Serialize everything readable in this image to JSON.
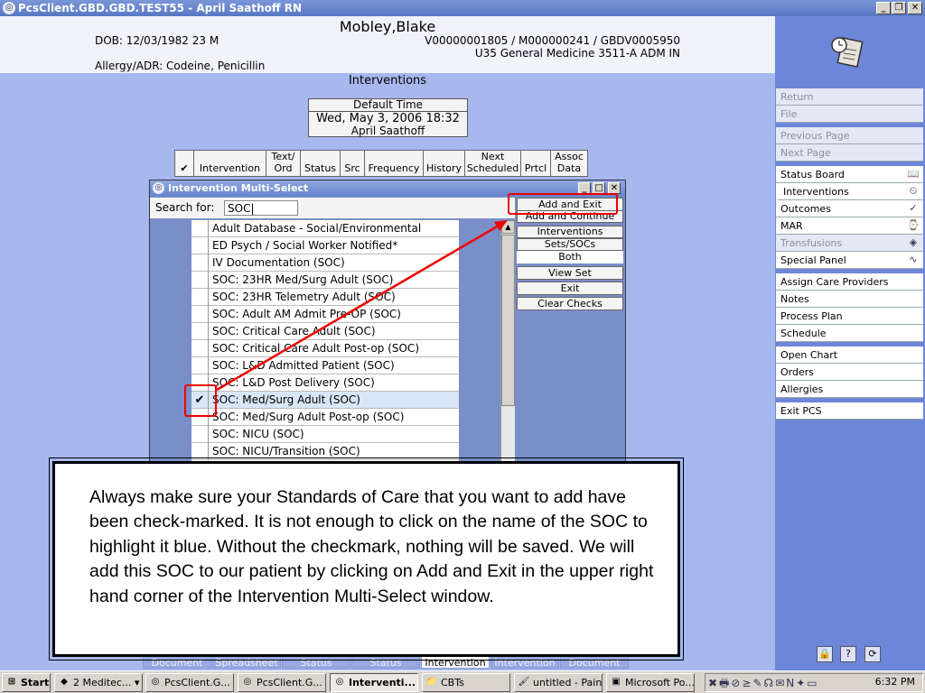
{
  "window": {
    "title": "PcsClient.GBD.GBD.TEST55 - April Saathoff RN"
  },
  "header": {
    "patient_name": "Mobley,Blake",
    "dob": "DOB: 12/03/1982 23 M",
    "ids": "V00000001805 / M000000241 / GBDV0005950",
    "location": "U35 General Medicine  3511-A  ADM IN",
    "allergy": "Allergy/ADR: Codeine, Penicillin"
  },
  "section_title": "Interventions",
  "default_time": {
    "label": "Default Time",
    "value": "Wed, May 3, 2006  18:32",
    "user": "April Saathoff"
  },
  "columns": [
    {
      "label": "✔"
    },
    {
      "label": "Intervention"
    },
    {
      "label": "Text/ Ord"
    },
    {
      "label": "Status"
    },
    {
      "label": "Src"
    },
    {
      "label": "Frequency"
    },
    {
      "label": "History"
    },
    {
      "label": "Next Scheduled"
    },
    {
      "label": "Prtcl"
    },
    {
      "label": "Assoc Data"
    }
  ],
  "dialog": {
    "title": "Intervention Multi-Select",
    "search_label": "Search for:",
    "search_value": "SOC|",
    "items": [
      {
        "label": "Adult Database - Social/Environmental",
        "checked": ""
      },
      {
        "label": "ED Psych / Social Worker Notified*",
        "checked": ""
      },
      {
        "label": "IV Documentation (SOC)",
        "checked": ""
      },
      {
        "label": "SOC: 23HR Med/Surg Adult (SOC)",
        "checked": ""
      },
      {
        "label": "SOC: 23HR Telemetry Adult (SOC)",
        "checked": ""
      },
      {
        "label": "SOC: Adult AM Admit Pre-OP (SOC)",
        "checked": ""
      },
      {
        "label": "SOC: Critical Care Adult (SOC)",
        "checked": ""
      },
      {
        "label": "SOC: Critical Care Adult Post-op (SOC)",
        "checked": ""
      },
      {
        "label": "SOC: L&D Admitted Patient (SOC)",
        "checked": ""
      },
      {
        "label": "SOC: L&D Post Delivery (SOC)",
        "checked": ""
      },
      {
        "label": "SOC: Med/Surg Adult (SOC)",
        "checked": "✔"
      },
      {
        "label": "SOC: Med/Surg Adult Post-op (SOC)",
        "checked": ""
      },
      {
        "label": "SOC: NICU (SOC)",
        "checked": ""
      },
      {
        "label": "SOC: NICU/Transition (SOC)",
        "checked": ""
      }
    ],
    "buttons": {
      "add_exit": "Add and Exit",
      "add_continue": "Add and Continue",
      "interventions": "Interventions",
      "sets_socs": "Sets/SOCs",
      "both": "Both",
      "view_set": "View Set",
      "exit": "Exit",
      "clear_checks": "Clear Checks"
    }
  },
  "sidebar": {
    "items": [
      {
        "label": "Return",
        "icon": ""
      },
      {
        "label": "File",
        "icon": ""
      },
      {
        "label": "Previous Page",
        "icon": ""
      },
      {
        "label": "Next Page",
        "icon": ""
      },
      {
        "label": "Status Board",
        "icon": "📖"
      },
      {
        "label": "Interventions",
        "icon": "⏲"
      },
      {
        "label": "Outcomes",
        "icon": "✓"
      },
      {
        "label": "MAR",
        "icon": "⌚"
      },
      {
        "label": "Transfusions",
        "icon": "◈"
      },
      {
        "label": "Special Panel",
        "icon": "∿"
      },
      {
        "label": "Assign Care Providers",
        "icon": ""
      },
      {
        "label": "Notes",
        "icon": ""
      },
      {
        "label": "Process Plan",
        "icon": ""
      },
      {
        "label": "Schedule",
        "icon": ""
      },
      {
        "label": "Open Chart",
        "icon": ""
      },
      {
        "label": "Orders",
        "icon": ""
      },
      {
        "label": "Allergies",
        "icon": ""
      },
      {
        "label": "Exit PCS",
        "icon": ""
      }
    ],
    "bottom_icons": [
      "🔒",
      "?",
      "⟳"
    ]
  },
  "tabs": [
    {
      "label": "Document"
    },
    {
      "label": "Spreadsheet"
    },
    {
      "label": "Status"
    },
    {
      "label": "Status"
    },
    {
      "label": "Intervention"
    },
    {
      "label": "Intervention"
    },
    {
      "label": "Document"
    }
  ],
  "callout": "Always make sure your Standards of Care that you want to add have been check-marked. It is not enough to click on the name of the SOC to highlight it blue. Without the checkmark, nothing will be saved. We will add this SOC to our patient by clicking on Add and Exit in the upper right hand corner of the Intervention Multi-Select window.",
  "taskbar": {
    "start": "Start",
    "items": [
      {
        "label": "2 Meditec...",
        "icon": "◆"
      },
      {
        "label": "PcsClient.G...",
        "icon": "◎"
      },
      {
        "label": "PcsClient.G...",
        "icon": "◎"
      },
      {
        "label": "Interventi...",
        "icon": "◎"
      },
      {
        "label": "CBTs",
        "icon": "📁"
      },
      {
        "label": "untitled - Paint",
        "icon": "🖌"
      },
      {
        "label": "Microsoft Po...",
        "icon": "▣"
      }
    ],
    "tray_icons": "✖🖶⊘≥✎☊✉N✦▭",
    "clock": "6:32 PM"
  },
  "colors": {
    "accent_red": "#e00000",
    "panel_blue": "#6e86d8",
    "background_blue": "#a7b8ee"
  }
}
